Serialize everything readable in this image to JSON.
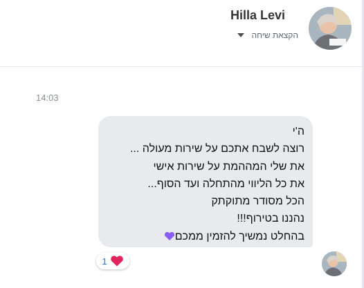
{
  "header": {
    "name": "Hilla Levi",
    "subtitle": "הקצאת שיחה"
  },
  "conversation": {
    "timestamp": "14:03",
    "message": {
      "lines": [
        "ה'י",
        "רוצה לשבח אתכם על שירות מעולה ...",
        "את שלי המההמת על שירות אישי",
        "את כל הליווי מהתחלה ועד הסוף...",
        "הכל מסודר מתוקתק",
        "נהננו בטירוף!!!",
        "בהחלט נמשיך להזמין ממכם"
      ],
      "trailing_emoji": "purple-heart-icon",
      "reaction": {
        "count": "1",
        "emoji": "red-heart-icon"
      }
    }
  },
  "colors": {
    "bubble": "#e9eaed",
    "reaction_count": "#1877f2",
    "heart_red": "#e0245e",
    "heart_purple": "#8b5cf6"
  }
}
